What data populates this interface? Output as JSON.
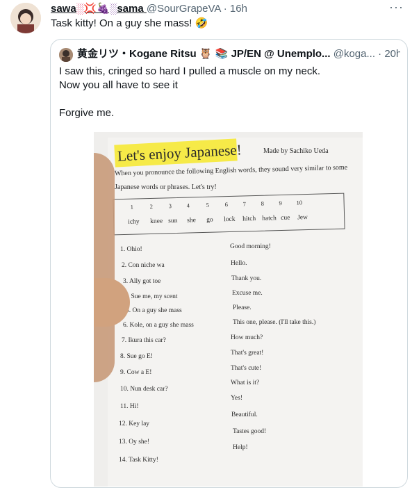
{
  "tweet": {
    "name_part1": "sawa",
    "name_part2": "sama",
    "handle": "@SourGrapeVA",
    "time": "· 16h",
    "text": "Task kitty! On a guy she mass! 🤣",
    "more": "···"
  },
  "quote": {
    "name": "黄金リツ・Kogane Ritsu",
    "name_tail": "JP/EN @ Unemplo...",
    "handle": "@koga...",
    "time": "· 20h",
    "line1": "I saw this, cringed so hard I pulled a muscle on my neck.",
    "line2": "Now you all have to see it",
    "line3": "Forgive me."
  },
  "photo": {
    "title": "Let's enjoy Japanese!",
    "made_by": "Made by Sachiko Ueda",
    "intro1": "When you pronounce the following English words, they sound very similar to some",
    "intro2": "Japanese words or phrases. Let's try!",
    "numbers": [
      "1",
      "2",
      "3",
      "4",
      "5",
      "6",
      "7",
      "8",
      "9",
      "10"
    ],
    "words": [
      "ichy",
      "knee",
      "sun",
      "she",
      "go",
      "lock",
      "hitch",
      "hatch",
      "cue",
      "Jew"
    ],
    "phrases": [
      "1. Ohio!",
      "2. Con niche wa",
      "3. Ally got toe",
      "4. Sue me, my scent",
      "5. On a guy she mass",
      "6. Kole, on a guy she mass",
      "7. Ikura this car?",
      "8. Sue go E!",
      "9. Cow a E!",
      "10. Nun desk car?",
      "11. Hi!",
      "12. Key lay",
      "13. Oy she!",
      "14. Task Kitty!"
    ],
    "meanings": [
      "Good morning!",
      "Hello.",
      "Thank you.",
      "Excuse me.",
      "Please.",
      "This one, please. (I'll take this.)",
      "How much?",
      "That's great!",
      "That's cute!",
      "What is it?",
      "Yes!",
      "Beautiful.",
      "Tastes good!",
      "Help!"
    ]
  }
}
